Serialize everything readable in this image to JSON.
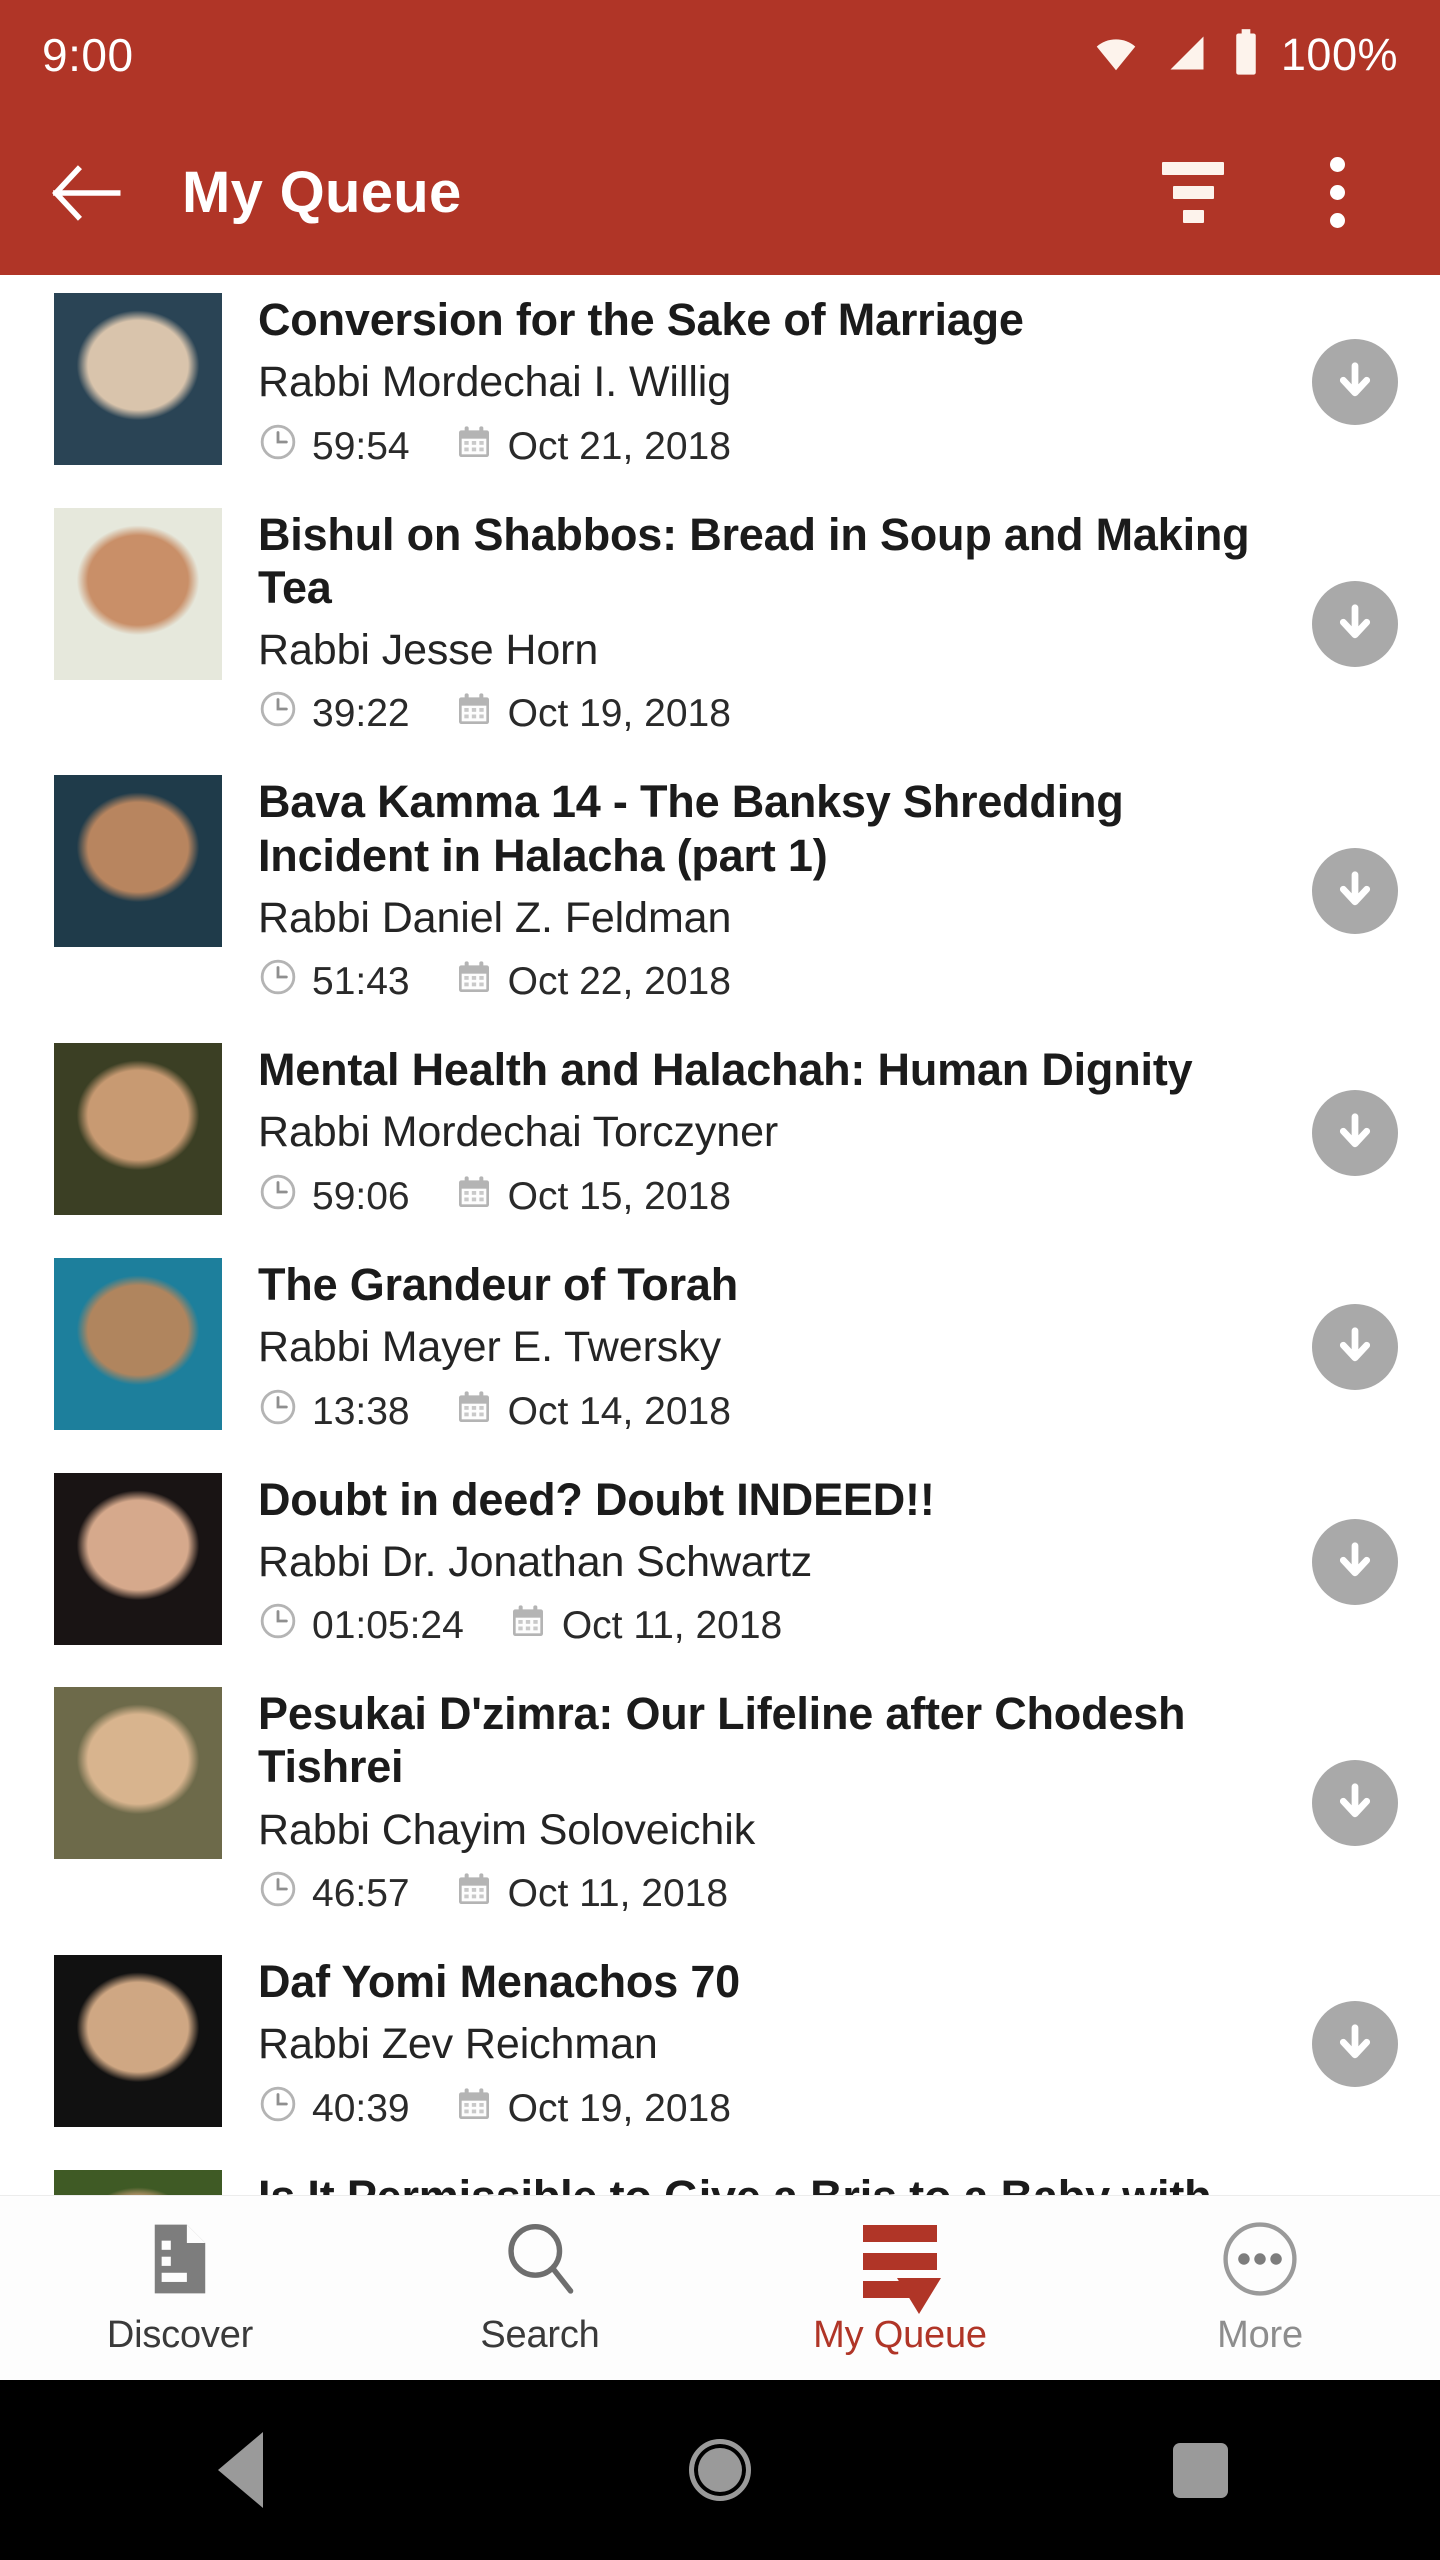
{
  "status_bar": {
    "time": "9:00",
    "battery_percent": "100%",
    "icons": [
      "wifi-icon",
      "cellular-signal-icon",
      "battery-icon"
    ]
  },
  "app_bar": {
    "back_label": "back-arrow",
    "title": "My Queue",
    "filter_label": "filter-icon",
    "overflow_label": "overflow-menu-icon",
    "background_color": "#b03527"
  },
  "queue": {
    "items": [
      {
        "title": "Conversion for the Sake of Marriage",
        "speaker": "Rabbi Mordechai I. Willig",
        "duration": "59:54",
        "date": "Oct 21, 2018",
        "action": "download",
        "thumb_color_a": "#2a4455",
        "thumb_color_b": "#d9c4ac"
      },
      {
        "title": "Bishul on Shabbos: Bread in Soup and Making Tea",
        "speaker": "Rabbi Jesse Horn",
        "duration": "39:22",
        "date": "Oct 19, 2018",
        "action": "download",
        "thumb_color_a": "#e6e8dc",
        "thumb_color_b": "#c98f68"
      },
      {
        "title": "Bava Kamma 14 - The Banksy Shredding Incident in Halacha (part 1)",
        "speaker": "Rabbi Daniel Z. Feldman",
        "duration": "51:43",
        "date": "Oct 22, 2018",
        "action": "download",
        "thumb_color_a": "#1f3b4a",
        "thumb_color_b": "#b8855f"
      },
      {
        "title": "Mental Health and Halachah: Human Dignity",
        "speaker": "Rabbi Mordechai Torczyner",
        "duration": "59:06",
        "date": "Oct 15, 2018",
        "action": "download",
        "thumb_color_a": "#3b3f24",
        "thumb_color_b": "#c89a72"
      },
      {
        "title": "The Grandeur of Torah",
        "speaker": "Rabbi Mayer E. Twersky",
        "duration": "13:38",
        "date": "Oct 14, 2018",
        "action": "download",
        "thumb_color_a": "#1d7f9c",
        "thumb_color_b": "#b0855e"
      },
      {
        "title": "Doubt in deed? Doubt INDEED!!",
        "speaker": "Rabbi Dr. Jonathan Schwartz",
        "duration": "01:05:24",
        "date": "Oct 11, 2018",
        "action": "download",
        "thumb_color_a": "#191414",
        "thumb_color_b": "#d6a98c"
      },
      {
        "title": "Pesukai D'zimra: Our Lifeline after Chodesh Tishrei",
        "speaker": "Rabbi Chayim Soloveichik",
        "duration": "46:57",
        "date": "Oct 11, 2018",
        "action": "download",
        "thumb_color_a": "#6d6a4a",
        "thumb_color_b": "#d8b48e"
      },
      {
        "title": "Daf Yomi Menachos 70",
        "speaker": "Rabbi Zev Reichman",
        "duration": "40:39",
        "date": "Oct 19, 2018",
        "action": "download",
        "thumb_color_a": "#111111",
        "thumb_color_b": "#cfa783"
      },
      {
        "title": "Is It Permissible to Give a Bris to a Baby with",
        "speaker": "",
        "duration": "",
        "date": "",
        "action": "download",
        "thumb_color_a": "#3f5a25",
        "thumb_color_b": "#cfa17a"
      }
    ],
    "clock_icon": "clock-icon",
    "calendar_icon": "calendar-icon",
    "download_icon": "download-icon"
  },
  "bottom_nav": {
    "active_color": "#b03527",
    "items": [
      {
        "label": "Discover",
        "icon": "document-icon",
        "active": false
      },
      {
        "label": "Search",
        "icon": "search-icon",
        "active": false
      },
      {
        "label": "My Queue",
        "icon": "queue-icon",
        "active": true
      },
      {
        "label": "More",
        "icon": "more-circle-icon",
        "active": false
      }
    ]
  },
  "android_nav": {
    "back": "back-triangle-icon",
    "home": "home-circle-icon",
    "recents": "recents-square-icon"
  }
}
